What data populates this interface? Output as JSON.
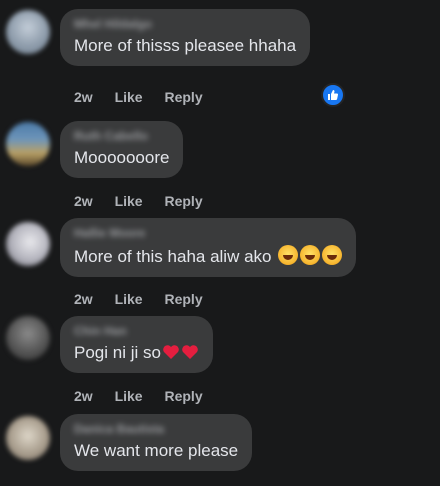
{
  "comments": [
    {
      "author": "Mhel Hildalgo",
      "text": "More of thisss pleasee hhaha",
      "emoji": [],
      "time": "2w",
      "like_label": "Like",
      "reply_label": "Reply",
      "reaction_icon": "like-reaction-icon",
      "avatar_colors": [
        "#c3cdd8",
        "#6f7e8e"
      ]
    },
    {
      "author": "Ruth Cabello",
      "text": "Mooooooore",
      "emoji": [],
      "time": "2w",
      "like_label": "Like",
      "reply_label": "Reply",
      "avatar_colors": [
        "#4b7aa8",
        "#b8a066"
      ]
    },
    {
      "author": "Hallie Moore",
      "text": "More of this haha aliw ako ",
      "emoji": [
        "rolling-on-floor-laughing-emoji",
        "rolling-on-floor-laughing-emoji",
        "rolling-on-floor-laughing-emoji"
      ],
      "time": "2w",
      "like_label": "Like",
      "reply_label": "Reply",
      "avatar_colors": [
        "#d8d8dc",
        "#8a8a95"
      ]
    },
    {
      "author": "Chin Han",
      "text": "Pogi ni ji so",
      "emoji": [
        "red-heart-emoji",
        "red-heart-emoji"
      ],
      "time": "2w",
      "like_label": "Like",
      "reply_label": "Reply",
      "avatar_colors": [
        "#6e6e6e",
        "#2d2d2d"
      ]
    },
    {
      "author": "Danica Bautista",
      "text": "We want more please",
      "emoji": [],
      "time": "",
      "like_label": "",
      "reply_label": "",
      "avatar_colors": [
        "#c7bfb0",
        "#7a6f62"
      ]
    }
  ],
  "colors": {
    "background": "#18191a",
    "bubble": "#3a3b3c",
    "text": "#e4e6eb",
    "meta": "#b0b3b8",
    "like_blue": "#1877f2",
    "heart_red": "#e41e3f"
  }
}
